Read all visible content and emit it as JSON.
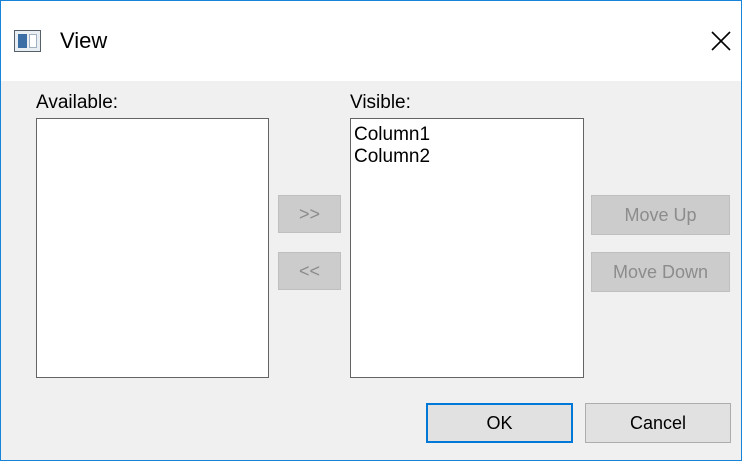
{
  "window": {
    "title": "View"
  },
  "icons": {
    "app": "window-view-icon",
    "close": "close-icon"
  },
  "available": {
    "label": "Available:",
    "items": []
  },
  "visible": {
    "label": "Visible:",
    "items": [
      "Column1",
      "Column2"
    ]
  },
  "buttons": {
    "add": ">>",
    "remove": "<<",
    "move_up": "Move Up",
    "move_down": "Move Down",
    "ok": "OK",
    "cancel": "Cancel"
  },
  "colors": {
    "window_border": "#1883d7",
    "default_button_border": "#0078d7",
    "disabled_text": "#8c8c8c"
  }
}
